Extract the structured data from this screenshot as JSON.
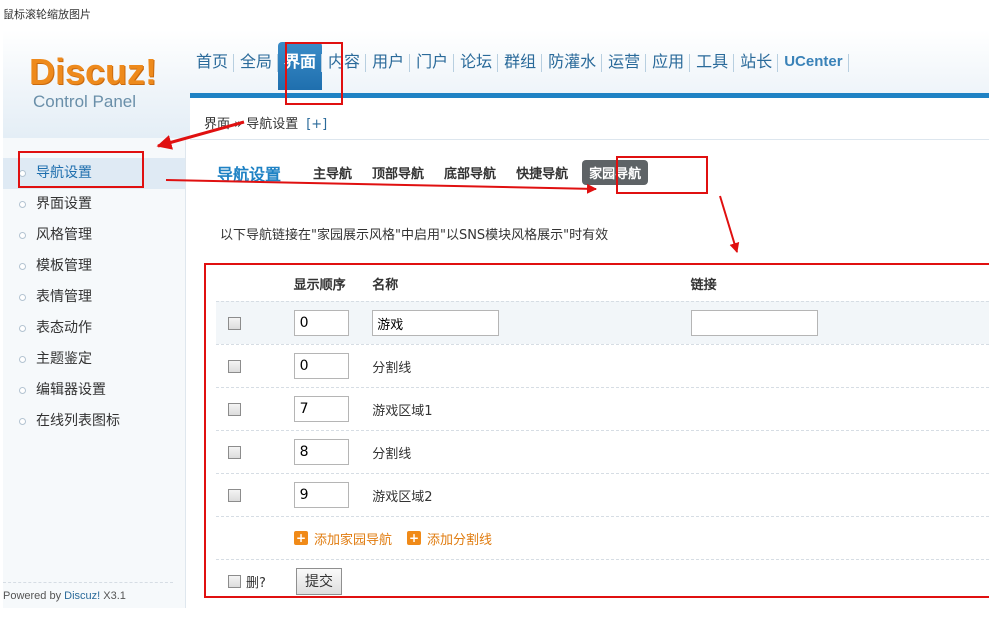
{
  "page_caption": "鼠标滚轮缩放图片",
  "logo": {
    "word": "Discuz!",
    "sub": "Control Panel"
  },
  "top_menu": [
    "首页",
    "全局",
    "界面",
    "内容",
    "用户",
    "门户",
    "论坛",
    "群组",
    "防灌水",
    "运营",
    "应用",
    "工具",
    "站长",
    "UCenter"
  ],
  "top_menu_active": "界面",
  "breadcrumb": {
    "path": "界面 » 导航设置",
    "plus": "[+]"
  },
  "sidebar": {
    "items": [
      "导航设置",
      "界面设置",
      "风格管理",
      "模板管理",
      "表情管理",
      "表态动作",
      "主题鉴定",
      "编辑器设置",
      "在线列表图标"
    ],
    "active": "导航设置"
  },
  "powered": {
    "prefix": "Powered by ",
    "brand": "Discuz!",
    "version": " X3.1"
  },
  "subtabs": {
    "title": "导航设置",
    "tabs": [
      "主导航",
      "顶部导航",
      "底部导航",
      "快捷导航"
    ],
    "current": "家园导航"
  },
  "note": "以下导航链接在\"家园展示风格\"中启用\"以SNS模块风格展示\"时有效",
  "table": {
    "headers": {
      "order": "显示顺序",
      "name": "名称",
      "link": "链接"
    },
    "rows": [
      {
        "order": "0",
        "name": "游戏",
        "editable": true
      },
      {
        "order": "0",
        "name": "分割线",
        "editable": false
      },
      {
        "order": "7",
        "name": "游戏区域1",
        "editable": false
      },
      {
        "order": "8",
        "name": "分割线",
        "editable": false
      },
      {
        "order": "9",
        "name": "游戏区域2",
        "editable": false
      }
    ],
    "add_home_nav": "添加家园导航",
    "add_divider": "添加分割线",
    "delete_label": "删?",
    "submit_label": "提交"
  },
  "colors": {
    "accent": "#1f82c4",
    "logo": "#ee8a1c",
    "annotation": "#e01010"
  }
}
